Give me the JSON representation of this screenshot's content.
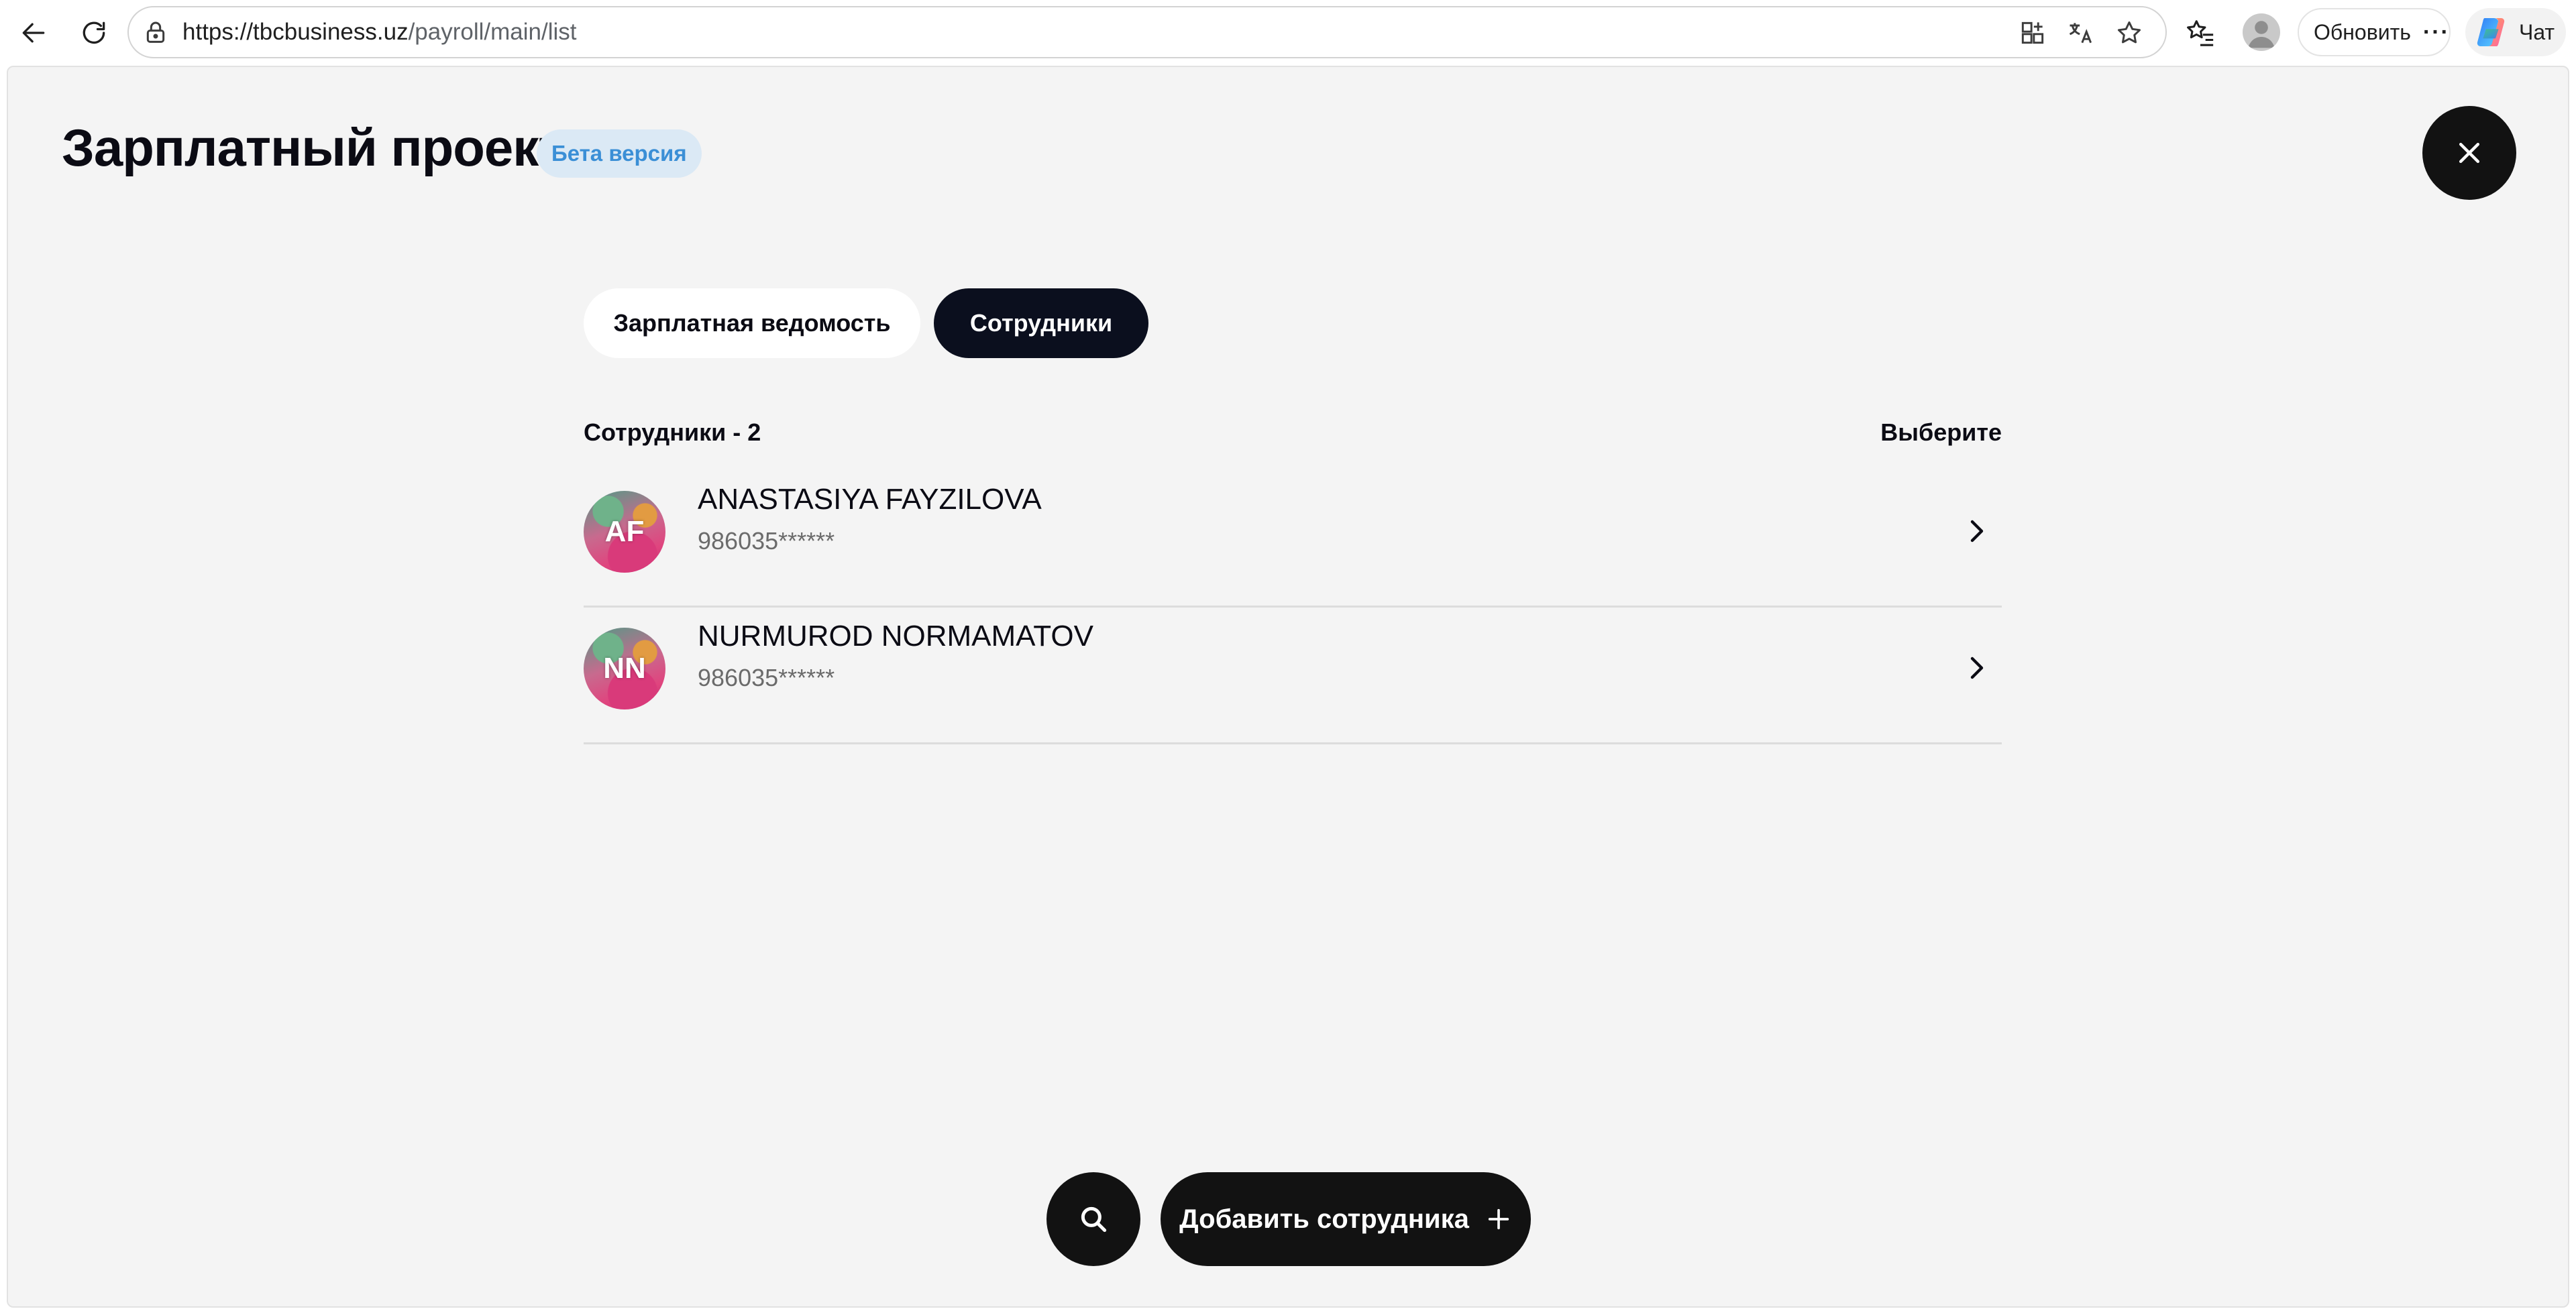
{
  "browser": {
    "url_host": "https://tbcbusiness.uz",
    "url_path": "/payroll/main/list",
    "update_label": "Обновить",
    "more_label": "···",
    "chat_label": "Чат"
  },
  "header": {
    "title": "Зарплатный проект",
    "badge": "Бета версия"
  },
  "tabs": [
    {
      "label": "Зарплатная ведомость",
      "active": false
    },
    {
      "label": "Сотрудники",
      "active": true
    }
  ],
  "list": {
    "count_label": "Сотрудники - 2",
    "select_label": "Выберите",
    "employees": [
      {
        "initials": "AF",
        "name": "ANASTASIYA FAYZILOVA",
        "phone": "986035******"
      },
      {
        "initials": "NN",
        "name": "NURMUROD NORMAMATOV",
        "phone": "986035******"
      }
    ]
  },
  "actions": {
    "add_employee_label": "Добавить сотрудника"
  },
  "colors": {
    "primary_dark": "#121212",
    "active_tab": "#0b0f1e",
    "badge_bg": "#dbe9f5",
    "badge_text": "#3b8fd6",
    "page_bg": "#f4f4f4"
  }
}
